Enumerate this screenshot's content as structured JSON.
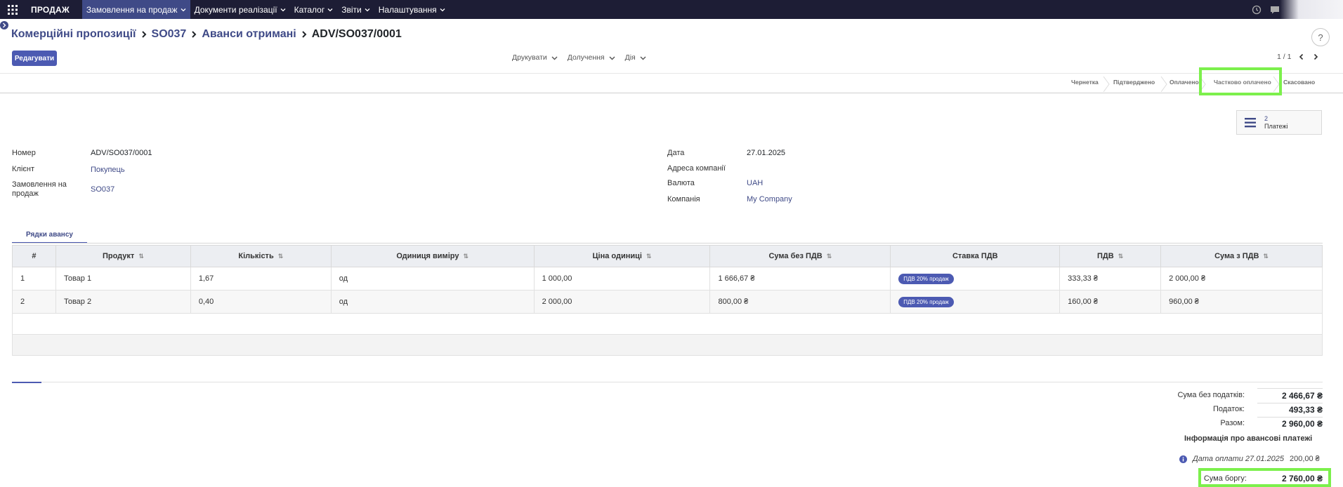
{
  "navbar": {
    "brand": "ПРОДАЖ",
    "menu": [
      {
        "label": "Замовлення на продаж",
        "active": true
      },
      {
        "label": "Документи реалізації",
        "active": false
      },
      {
        "label": "Каталог",
        "active": false
      },
      {
        "label": "Звіти",
        "active": false
      },
      {
        "label": "Налаштування",
        "active": false
      }
    ]
  },
  "breadcrumb": {
    "items": [
      "Комерційні пропозиції",
      "SO037",
      "Аванси отримані"
    ],
    "current": "ADV/SO037/0001"
  },
  "help_label": "?",
  "toolbar": {
    "edit_label": "Редагувати",
    "actions": [
      "Друкувати",
      "Долучення",
      "Дія"
    ],
    "pager": "1 / 1"
  },
  "statusbar": {
    "stages": [
      "Чернетка",
      "Підтверджено",
      "Оплачено",
      "Частково оплачено",
      "Скасовано"
    ],
    "current": "Частково оплачено"
  },
  "smart_button": {
    "count": "2",
    "label": "Платежі"
  },
  "form": {
    "left": [
      {
        "label": "Номер",
        "value": "ADV/SO037/0001",
        "link": false
      },
      {
        "label": "Клієнт",
        "value": "Покупець",
        "link": true
      },
      {
        "label": "Замовлення на продаж",
        "value": "SO037",
        "link": true
      }
    ],
    "right": [
      {
        "label": "Дата",
        "value": "27.01.2025",
        "link": false
      },
      {
        "label": "Адреса компанії",
        "value": "",
        "link": false
      },
      {
        "label": "Валюта",
        "value": "UAH",
        "link": true
      },
      {
        "label": "Компанія",
        "value": "My Company",
        "link": true
      }
    ]
  },
  "tab_label": "Рядки авансу",
  "table": {
    "columns": [
      "#",
      "Продукт",
      "Кількість",
      "Одиниця виміру",
      "Ціна одиниці",
      "Сума без ПДВ",
      "Ставка ПДВ",
      "ПДВ",
      "Сума з ПДВ"
    ],
    "rows": [
      [
        "1",
        "Товар 1",
        "1,67",
        "од",
        "1 000,00",
        "1 666,67 ₴",
        "ПДВ 20% продаж",
        "333,33 ₴",
        "2 000,00 ₴"
      ],
      [
        "2",
        "Товар 2",
        "0,40",
        "од",
        "2 000,00",
        "800,00 ₴",
        "ПДВ 20% продаж",
        "160,00 ₴",
        "960,00 ₴"
      ]
    ]
  },
  "totals": {
    "untaxed_label": "Сума без податків:",
    "untaxed": "2 466,67 ₴",
    "tax_label": "Податок:",
    "tax": "493,33 ₴",
    "total_label": "Разом:",
    "total": "2 960,00 ₴",
    "advance_title": "Інформація про авансові платежі",
    "payment_label": "Дата оплати 27.01.2025",
    "payment_amount": "200,00 ₴",
    "debt_label": "Сума боргу:",
    "debt": "2 760,00 ₴"
  },
  "colors": {
    "navbar": "#1d1d35",
    "accent": "#4c5ab2",
    "link": "#3f4a87",
    "highlight": "#7cf04c"
  }
}
